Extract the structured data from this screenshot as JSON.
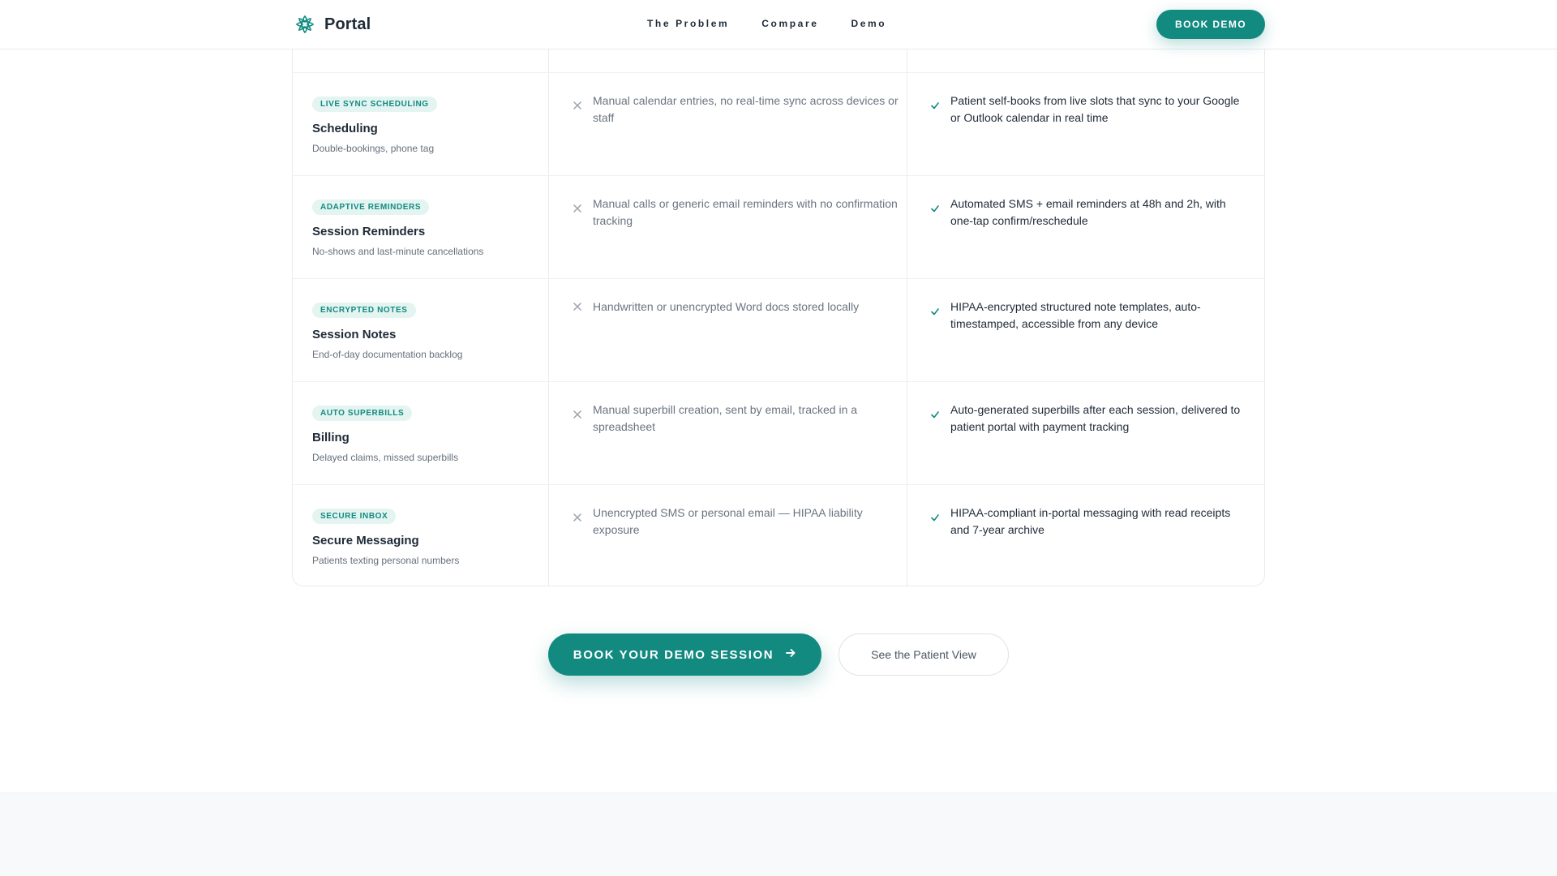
{
  "header": {
    "brand": "Portal",
    "nav": [
      "The Problem",
      "Compare",
      "Demo"
    ],
    "cta": "BOOK DEMO"
  },
  "comparison": {
    "rows": [
      {
        "badge": "LIVE SYNC SCHEDULING",
        "title": "Scheduling",
        "sub": "Double-bookings, phone tag",
        "old": "Manual calendar entries, no real-time sync across devices or staff",
        "new": "Patient self-books from live slots that sync to your Google or Outlook calendar in real time"
      },
      {
        "badge": "ADAPTIVE REMINDERS",
        "title": "Session Reminders",
        "sub": "No-shows and last-minute cancellations",
        "old": "Manual calls or generic email reminders with no confirmation tracking",
        "new": "Automated SMS + email reminders at 48h and 2h, with one-tap confirm/reschedule"
      },
      {
        "badge": "ENCRYPTED NOTES",
        "title": "Session Notes",
        "sub": "End-of-day documentation backlog",
        "old": "Handwritten or unencrypted Word docs stored locally",
        "new": "HIPAA-encrypted structured note templates, auto-timestamped, accessible from any device"
      },
      {
        "badge": "AUTO SUPERBILLS",
        "title": "Billing",
        "sub": "Delayed claims, missed superbills",
        "old": "Manual superbill creation, sent by email, tracked in a spreadsheet",
        "new": "Auto-generated superbills after each session, delivered to patient portal with payment tracking"
      },
      {
        "badge": "SECURE INBOX",
        "title": "Secure Messaging",
        "sub": "Patients texting personal numbers",
        "old": "Unencrypted SMS or personal email — HIPAA liability exposure",
        "new": "HIPAA-compliant in-portal messaging with read receipts and 7-year archive"
      }
    ]
  },
  "cta": {
    "primary": "BOOK YOUR DEMO SESSION",
    "secondary": "See the Patient View"
  },
  "colors": {
    "accent": "#138a80",
    "badge_bg": "#e3f4f1",
    "text": "#1f2a37",
    "muted": "#6b7480"
  }
}
